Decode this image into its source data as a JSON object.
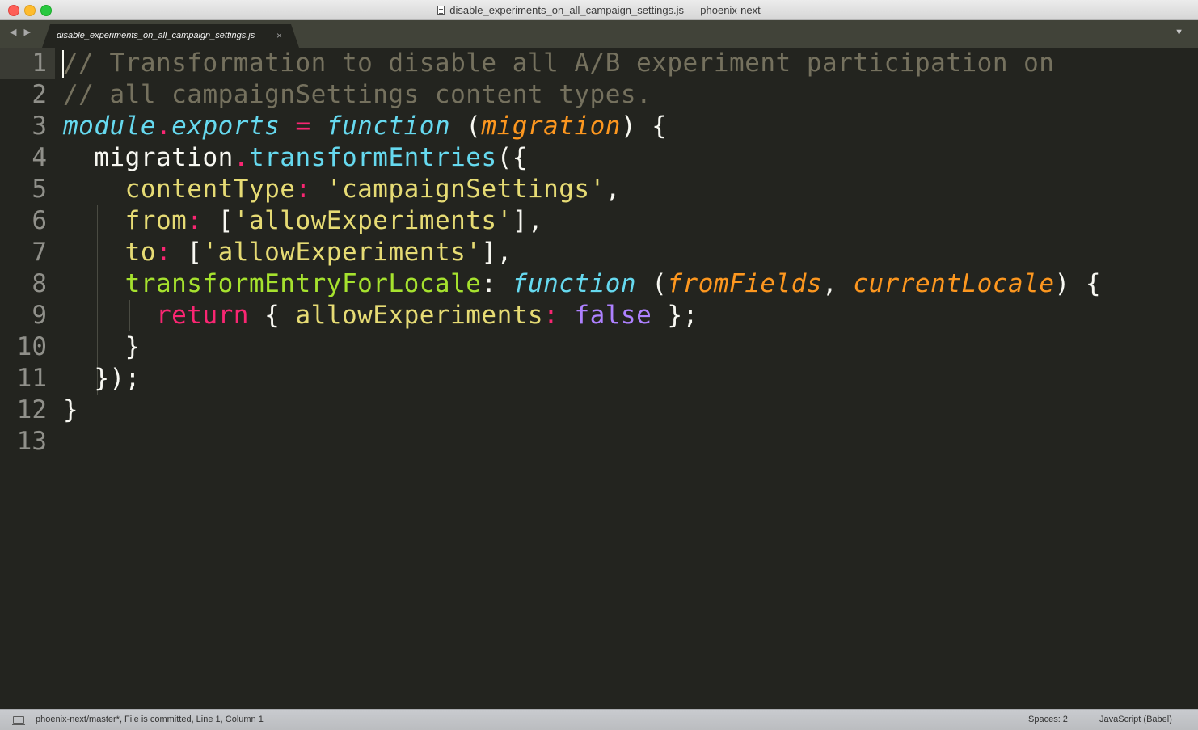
{
  "window": {
    "title": "disable_experiments_on_all_campaign_settings.js — phoenix-next"
  },
  "tabbar": {
    "nav_arrows": "◀ ▶",
    "tab_label": "disable_experiments_on_all_campaign_settings.js",
    "tab_close": "×",
    "dropdown": "▼"
  },
  "editor": {
    "active_line": 1,
    "line_numbers": [
      "1",
      "2",
      "3",
      "4",
      "5",
      "6",
      "7",
      "8",
      "9",
      "10",
      "11",
      "12",
      "13"
    ],
    "lines": [
      [
        {
          "t": "// Transformation to disable all A/B experiment participation on",
          "c": "comment"
        }
      ],
      [
        {
          "t": "// all campaignSettings content types.",
          "c": "comment"
        }
      ],
      [
        {
          "t": "module",
          "c": "cyan-i"
        },
        {
          "t": ".",
          "c": "pink"
        },
        {
          "t": "exports",
          "c": "cyan-i"
        },
        {
          "t": " ",
          "c": "white"
        },
        {
          "t": "=",
          "c": "pink"
        },
        {
          "t": " ",
          "c": "white"
        },
        {
          "t": "function",
          "c": "cyan-i"
        },
        {
          "t": " (",
          "c": "white"
        },
        {
          "t": "migration",
          "c": "orange-i"
        },
        {
          "t": ") {",
          "c": "white"
        }
      ],
      [
        {
          "t": "  migration",
          "c": "white"
        },
        {
          "t": ".",
          "c": "pink"
        },
        {
          "t": "transformEntries",
          "c": "cyan"
        },
        {
          "t": "({",
          "c": "white"
        }
      ],
      [
        {
          "t": "    contentType",
          "c": "yellow"
        },
        {
          "t": ":",
          "c": "pink"
        },
        {
          "t": " ",
          "c": "white"
        },
        {
          "t": "'campaignSettings'",
          "c": "yellow"
        },
        {
          "t": ",",
          "c": "white"
        }
      ],
      [
        {
          "t": "    from",
          "c": "yellow"
        },
        {
          "t": ":",
          "c": "pink"
        },
        {
          "t": " [",
          "c": "white"
        },
        {
          "t": "'allowExperiments'",
          "c": "yellow"
        },
        {
          "t": "],",
          "c": "white"
        }
      ],
      [
        {
          "t": "    to",
          "c": "yellow"
        },
        {
          "t": ":",
          "c": "pink"
        },
        {
          "t": " [",
          "c": "white"
        },
        {
          "t": "'allowExperiments'",
          "c": "yellow"
        },
        {
          "t": "],",
          "c": "white"
        }
      ],
      [
        {
          "t": "    transformEntryForLocale",
          "c": "green"
        },
        {
          "t": ": ",
          "c": "white"
        },
        {
          "t": "function",
          "c": "cyan-i"
        },
        {
          "t": " (",
          "c": "white"
        },
        {
          "t": "fromFields",
          "c": "orange-i"
        },
        {
          "t": ", ",
          "c": "white"
        },
        {
          "t": "currentLocale",
          "c": "orange-i"
        },
        {
          "t": ") {",
          "c": "white"
        }
      ],
      [
        {
          "t": "      ",
          "c": "white"
        },
        {
          "t": "return",
          "c": "pink"
        },
        {
          "t": " { ",
          "c": "white"
        },
        {
          "t": "allowExperiments",
          "c": "yellow"
        },
        {
          "t": ":",
          "c": "pink"
        },
        {
          "t": " ",
          "c": "white"
        },
        {
          "t": "false",
          "c": "purple"
        },
        {
          "t": " };",
          "c": "white"
        }
      ],
      [
        {
          "t": "    }",
          "c": "white"
        }
      ],
      [
        {
          "t": "  });",
          "c": "white"
        }
      ],
      [
        {
          "t": "}",
          "c": "white"
        }
      ],
      []
    ]
  },
  "statusbar": {
    "left_text": "phoenix-next/master*, File is committed, Line 1, Column 1",
    "spaces": "Spaces: 2",
    "syntax": "JavaScript (Babel)"
  },
  "colors": {
    "background": "#23241f",
    "comment": "#75715e",
    "keyword_cyan": "#66d9ef",
    "operator_pink": "#f92672",
    "param_orange": "#fd971f",
    "string_yellow": "#e6db74",
    "function_green": "#a6e22e",
    "constant_purple": "#ae81ff"
  }
}
